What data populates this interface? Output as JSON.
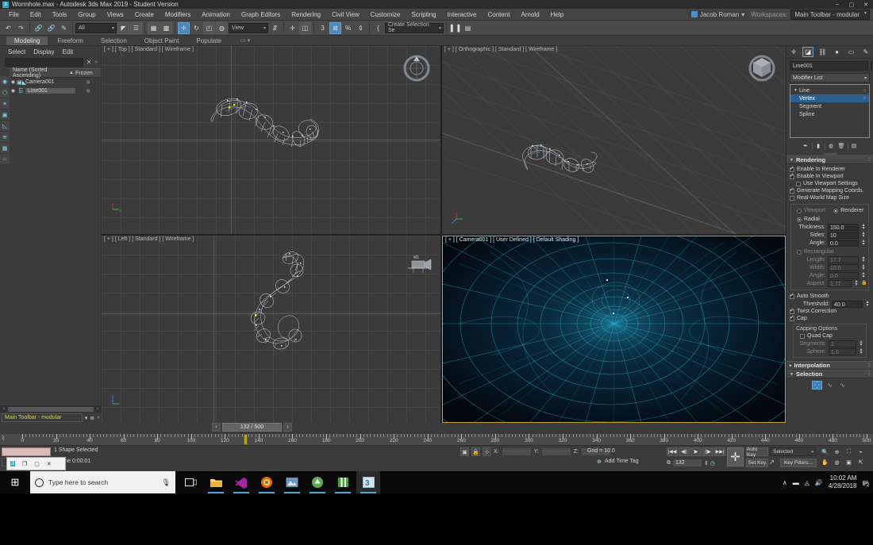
{
  "window": {
    "title": "Wormhole.max - Autodesk 3ds Max 2019 - Student Version",
    "app_icon": "max-icon",
    "minimize": "–",
    "maximize": "▢",
    "close": "✕"
  },
  "menu": {
    "items": [
      "File",
      "Edit",
      "Tools",
      "Group",
      "Views",
      "Create",
      "Modifiers",
      "Animation",
      "Graph Editors",
      "Rendering",
      "Civil View",
      "Customize",
      "Scripting",
      "Interactive",
      "Content",
      "Arnold",
      "Help"
    ],
    "user": "Jacob Roman",
    "workspaces_label": "Workspaces:",
    "workspace_value": "Main Toolbar - modular"
  },
  "toolbar": {
    "selection_filter": "All",
    "reference_coord": "View",
    "selection_set": "Create Selection Se",
    "buttons": [
      {
        "name": "undo-button",
        "glyph": "↶"
      },
      {
        "name": "redo-button",
        "glyph": "↷"
      },
      {
        "name": "select-link-button",
        "glyph": "⛓"
      },
      {
        "name": "unlink-button",
        "glyph": "⛓"
      },
      {
        "name": "bind-to-space-warp-button",
        "glyph": "✦"
      },
      {
        "name": "select-object-button",
        "glyph": "◣"
      },
      {
        "name": "select-by-name-button",
        "glyph": "☰"
      },
      {
        "name": "rectangular-selection-region-button",
        "glyph": "▭"
      },
      {
        "name": "window-crossing-button",
        "glyph": "▣"
      },
      {
        "name": "select-and-move-button",
        "glyph": "✛"
      },
      {
        "name": "select-and-rotate-button",
        "glyph": "↻"
      },
      {
        "name": "select-and-scale-button",
        "glyph": "◱"
      },
      {
        "name": "select-and-place-button",
        "glyph": "◍"
      },
      {
        "name": "use-center-flyout-button",
        "glyph": "⇵"
      },
      {
        "name": "align-button",
        "glyph": "✛"
      },
      {
        "name": "mirror-button",
        "glyph": "⊡"
      },
      {
        "name": "angle-snap-toggle-button",
        "glyph": "3"
      },
      {
        "name": "percent-snap-toggle-button",
        "glyph": "%"
      },
      {
        "name": "spinner-snap-toggle-button",
        "glyph": "⇕"
      },
      {
        "name": "named-selection-button",
        "glyph": "{"
      },
      {
        "name": "mirror-panel-button",
        "glyph": "▌▐"
      },
      {
        "name": "layer-explorer-button",
        "glyph": "▤"
      }
    ]
  },
  "ribbon": {
    "tabs": [
      "Modeling",
      "Freeform",
      "Selection",
      "Object Paint",
      "Populate"
    ],
    "active_tab": "Modeling",
    "mini": "▭ ▾"
  },
  "explorer": {
    "menus": [
      "Select",
      "Display",
      "Edit"
    ],
    "search_placeholder": "",
    "clear_icon": "✕",
    "expand_icon": "»",
    "columns": [
      "Name (Sorted Ascending)",
      "Frozen"
    ],
    "sort_arrow": "▲",
    "rows": [
      {
        "name": "Camera001",
        "type_icon": "camera-icon",
        "eye": "◉",
        "frozen": "❄",
        "selected": false
      },
      {
        "name": "Line001",
        "type_icon": "shape-icon",
        "eye": "◉",
        "frozen": "❄",
        "selected": true
      }
    ],
    "vertical_tools": [
      "◉",
      "⟳",
      "💡",
      "▣",
      "◺",
      "≋",
      "▩",
      "⌂"
    ],
    "footer_field": "Main Toolbar - modular",
    "footer_dropdown": "▾",
    "footer_icon": "≣",
    "footer_chev": "»",
    "scroll_left": "‹",
    "scroll_right": "›"
  },
  "viewports": [
    {
      "name": "viewport-top",
      "label": "[ + ] [ Top ] [ Standard ] [ Wireframe ]",
      "active": false
    },
    {
      "name": "viewport-orthographic",
      "label": "[ + ] [ Orthographic ] [ Standard ] [ Wireframe ]",
      "active": false
    },
    {
      "name": "viewport-left",
      "label": "[ + ] [ Left ] [ Standard ] [ Wireframe ]",
      "active": false
    },
    {
      "name": "viewport-camera",
      "label": "[ + ] [ Camera001 ] [ User Defined ] [ Default Shading ]",
      "active": true
    }
  ],
  "command_panel": {
    "tabs": [
      {
        "name": "create-tab",
        "glyph": "✛",
        "active": false
      },
      {
        "name": "modify-tab",
        "glyph": "◩",
        "active": true
      },
      {
        "name": "hierarchy-tab",
        "glyph": "品",
        "active": false
      },
      {
        "name": "motion-tab",
        "glyph": "●",
        "active": false
      },
      {
        "name": "display-tab",
        "glyph": "▭",
        "active": false
      },
      {
        "name": "utilities-tab",
        "glyph": "🔧",
        "active": false
      }
    ],
    "object_name": "Line001",
    "object_color": "#e8bcd9",
    "modifier_list": "Modifier List",
    "stack": [
      {
        "label": "Line",
        "selected": false,
        "indent": 0,
        "caret": "▼",
        "pin": "⁙"
      },
      {
        "label": "Vertex",
        "selected": true,
        "indent": 1,
        "caret": "",
        "pin": "⁙"
      },
      {
        "label": "Segment",
        "selected": false,
        "indent": 1,
        "caret": "",
        "pin": ""
      },
      {
        "label": "Spline",
        "selected": false,
        "indent": 1,
        "caret": "",
        "pin": ""
      }
    ],
    "stack_tools": [
      "✎",
      "▮",
      "◍",
      "🗑",
      "📝"
    ],
    "rendering": {
      "title": "Rendering",
      "enable_in_renderer": {
        "label": "Enable In Renderer",
        "checked": true
      },
      "enable_in_viewport": {
        "label": "Enable In Viewport",
        "checked": true
      },
      "use_viewport_settings": {
        "label": "Use Viewport Settings",
        "checked": false
      },
      "generate_mapping_coords": {
        "label": "Generate Mapping Coords.",
        "checked": true
      },
      "real_world_map_size": {
        "label": "Real-World Map Size",
        "checked": false
      },
      "viewport_radio": {
        "label": "Viewport",
        "selected": false
      },
      "renderer_radio": {
        "label": "Renderer",
        "selected": true
      },
      "radial": {
        "label": "Radial",
        "selected": true
      },
      "thickness": {
        "label": "Thickness:",
        "value": "150.0"
      },
      "sides": {
        "label": "Sides:",
        "value": "10"
      },
      "angle": {
        "label": "Angle:",
        "value": "0.0"
      },
      "rectangular": {
        "label": "Rectangular",
        "selected": false
      },
      "length": {
        "label": "Length:",
        "value": "17.7"
      },
      "width": {
        "label": "Width:",
        "value": "10.0"
      },
      "rect_angle": {
        "label": "Angle:",
        "value": "0.0"
      },
      "aspect": {
        "label": "Aspect:",
        "value": "1.77"
      },
      "auto_smooth": {
        "label": "Auto Smooth",
        "checked": true
      },
      "threshold": {
        "label": "Threshold:",
        "value": "40.0"
      },
      "twist_correction": {
        "label": "Twist Correction",
        "checked": true
      },
      "cap": {
        "label": "Cap",
        "checked": true
      },
      "capping_options": "Capping Options",
      "quad_cap": {
        "label": "Quad Cap",
        "checked": false
      },
      "segments": {
        "label": "Segments:",
        "value": "1"
      },
      "sphere": {
        "label": "Sphere:",
        "value": "1.0"
      }
    },
    "interpolation": {
      "title": "Interpolation"
    },
    "selection": {
      "title": "Selection",
      "icons": [
        {
          "name": "vertex-sub-object-icon",
          "glyph": "⁛",
          "active": true
        },
        {
          "name": "segment-sub-object-icon",
          "glyph": "∿",
          "active": false
        },
        {
          "name": "spline-sub-object-icon",
          "glyph": "∿",
          "active": false
        }
      ]
    }
  },
  "timeline": {
    "current_frame_label": "132 / 500",
    "prev_arrow": "‹",
    "next_arrow": "›",
    "key_icon": "⌇",
    "tick_labels": [
      "0",
      "20",
      "40",
      "60",
      "80",
      "100",
      "120",
      "140",
      "160",
      "180",
      "200",
      "220",
      "240",
      "260",
      "280",
      "300",
      "320",
      "340",
      "360",
      "380",
      "400",
      "420",
      "440",
      "460",
      "480",
      "500"
    ],
    "range_start": 0,
    "range_end": 500,
    "playhead_frame": 132
  },
  "statusbar": {
    "selection_status": "1 Shape Selected",
    "render_time": "g Time  0:00:01",
    "coord_labels": [
      "X:",
      "Y:",
      "Z:"
    ],
    "coord_values": [
      "",
      "",
      ""
    ],
    "grid": "Grid = 10.0",
    "add_time_tag": "Add Time Tag",
    "lock_icon": "🔒",
    "selection_lock_icon": "▣",
    "absolute_mode_icon": "⊹",
    "playback": [
      "|◀◀",
      "◀||",
      "▶",
      "||▶",
      "▶▶|"
    ],
    "frame_value": "132",
    "key_mode_icon": "⧉",
    "auto_key": "Auto Key",
    "set_key": "Set Key",
    "selected_filter": "Selected",
    "key_filters": "Key Filters...",
    "big_key_icon": "✛",
    "curve_editor_icon": "↗",
    "nav_icons": [
      "🔍",
      "⟳",
      "✛",
      "◎",
      "▣",
      "⊞",
      "◨",
      "⤢"
    ]
  },
  "popup": {
    "icon": "3",
    "restore_icon": "❐",
    "max_icon": "▢",
    "close_icon": "✕"
  },
  "taskbar": {
    "start_icon": "⊞",
    "search_placeholder": "Type here to search",
    "mic_icon": "🎤",
    "items": [
      {
        "name": "task-view-icon",
        "glyph": "❐",
        "color": "#e6e6e6",
        "active": false
      },
      {
        "name": "file-explorer-icon",
        "glyph": "📁",
        "color": "#f0c040",
        "active": false
      },
      {
        "name": "vs-code-icon",
        "glyph": "◤",
        "color": "#a020a0",
        "active": false
      },
      {
        "name": "firefox-icon",
        "glyph": "●",
        "color": "#e86a10",
        "active": false
      },
      {
        "name": "photo-app-icon",
        "glyph": "▦",
        "color": "#5a8ac0",
        "active": false
      },
      {
        "name": "unity-app-icon",
        "glyph": "◉",
        "color": "#5ab050",
        "active": false
      },
      {
        "name": "office-app-icon",
        "glyph": "▮",
        "color": "#4aa03a",
        "active": false
      },
      {
        "name": "3ds-max-icon",
        "glyph": "3",
        "color": "#2fa8c8",
        "active": true
      }
    ],
    "tray": {
      "chevron": "∧",
      "network_icon": "📶",
      "wifi_icon": "◬",
      "volume_icon": "🔊",
      "time": "10:02 AM",
      "date": "4/28/2018",
      "notification_count": "2"
    }
  }
}
